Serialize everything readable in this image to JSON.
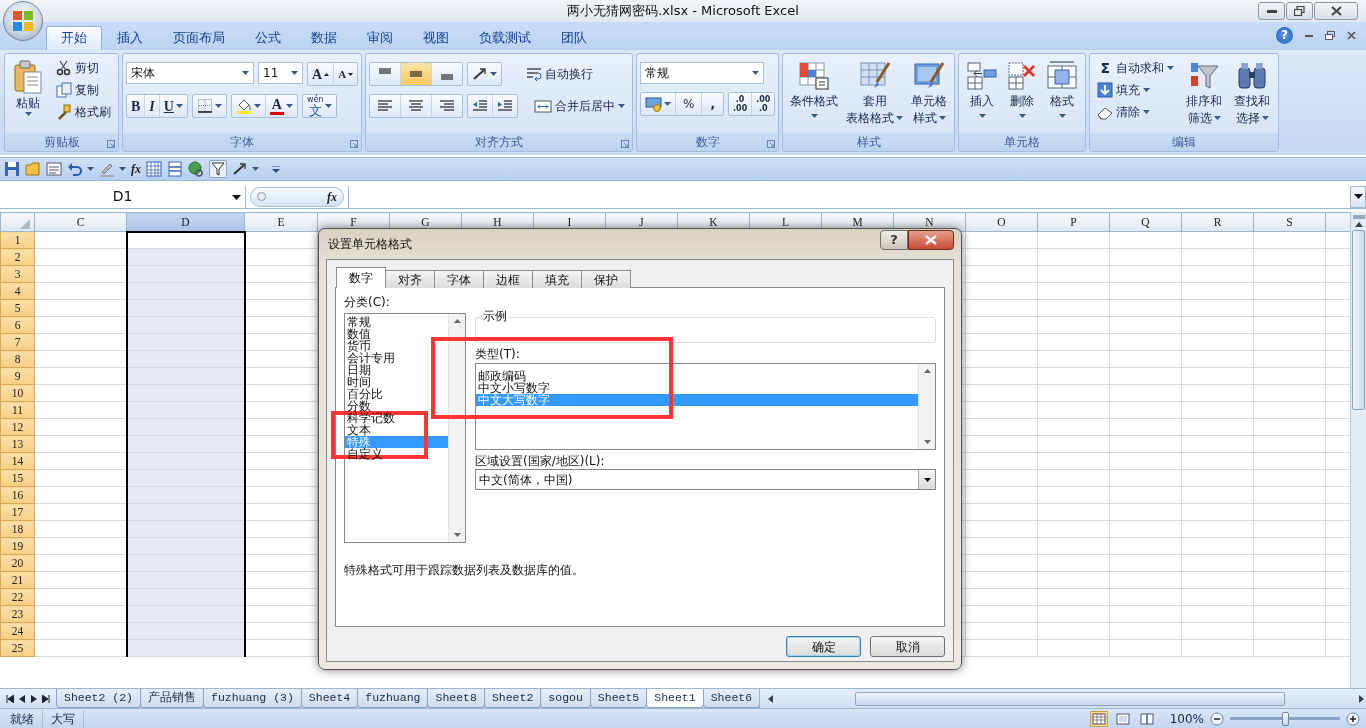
{
  "window": {
    "title": "两小无猜网密码.xlsx - Microsoft Excel"
  },
  "ribbon_tabs": [
    {
      "label": "开始",
      "selected": true
    },
    {
      "label": "插入",
      "selected": false
    },
    {
      "label": "页面布局",
      "selected": false
    },
    {
      "label": "公式",
      "selected": false
    },
    {
      "label": "数据",
      "selected": false
    },
    {
      "label": "审阅",
      "selected": false
    },
    {
      "label": "视图",
      "selected": false
    },
    {
      "label": "负载测试",
      "selected": false
    },
    {
      "label": "团队",
      "selected": false
    }
  ],
  "ribbon_help": "?",
  "clipboard": {
    "title": "剪贴板",
    "launcher": true,
    "paste": "粘贴",
    "actions": [
      {
        "kind": "cut",
        "label": "剪切"
      },
      {
        "kind": "copy",
        "label": "复制"
      },
      {
        "kind": "brush",
        "label": "格式刷"
      }
    ]
  },
  "font": {
    "title": "字体",
    "launcher": true,
    "font_name": "宋体",
    "font_size": "11",
    "grow": "A",
    "shrink": "A",
    "styles": [
      "B",
      "I",
      "U"
    ],
    "font_color": "A",
    "phonetic": {
      "ruby": "wén",
      "char": "文"
    }
  },
  "alignment": {
    "title": "对齐方式",
    "launcher": true,
    "vertical": [
      {
        "selected": false
      },
      {
        "selected": true
      },
      {
        "selected": false
      }
    ],
    "wrap": "自动换行",
    "merge": "合并后居中"
  },
  "number": {
    "title": "数字",
    "launcher": true,
    "format": "常规",
    "percent": "%",
    "comma": ",",
    "decimals": [
      {
        "top": ".0",
        "bottom": ".00"
      },
      {
        "top": ".00",
        "bottom": ".0"
      }
    ]
  },
  "styles": {
    "title": "样式",
    "buttons": [
      {
        "kind": "conditional",
        "lines": [
          "条件格式"
        ]
      },
      {
        "kind": "table",
        "lines": [
          "套用",
          "表格格式"
        ]
      },
      {
        "kind": "cellstyle",
        "lines": [
          "单元格",
          "样式"
        ]
      }
    ]
  },
  "cells": {
    "title": "单元格",
    "buttons": [
      {
        "kind": "insert",
        "lines": [
          "插入"
        ]
      },
      {
        "kind": "delete",
        "lines": [
          "删除"
        ]
      },
      {
        "kind": "format",
        "lines": [
          "格式"
        ]
      }
    ]
  },
  "editing": {
    "title": "编辑",
    "sum_symbol": "Σ",
    "small": [
      {
        "kind": "sum",
        "label": "自动求和"
      },
      {
        "kind": "fill",
        "label": "填充"
      },
      {
        "kind": "clear",
        "label": "清除"
      }
    ],
    "large": [
      {
        "kind": "sort",
        "lines": [
          "排序和",
          "筛选"
        ]
      },
      {
        "kind": "find",
        "lines": [
          "查找和",
          "选择"
        ]
      }
    ]
  },
  "quick_access": {
    "fx": "fx"
  },
  "formula_bar": {
    "name_box": "D1",
    "fx": "fx"
  },
  "grid": {
    "columns": [
      {
        "label": "C",
        "selected": false
      },
      {
        "label": "D",
        "selected": true
      },
      {
        "label": "E",
        "selected": false
      },
      {
        "label": "F",
        "selected": false
      },
      {
        "label": "G",
        "selected": false
      },
      {
        "label": "H",
        "selected": false
      },
      {
        "label": "I",
        "selected": false
      },
      {
        "label": "J",
        "selected": false
      },
      {
        "label": "K",
        "selected": false
      },
      {
        "label": "L",
        "selected": false
      },
      {
        "label": "M",
        "selected": false
      },
      {
        "label": "N",
        "selected": false
      },
      {
        "label": "O",
        "selected": false
      },
      {
        "label": "P",
        "selected": false
      },
      {
        "label": "Q",
        "selected": false
      },
      {
        "label": "R",
        "selected": false
      },
      {
        "label": "S",
        "selected": false
      }
    ],
    "rows": [
      "1",
      "2",
      "3",
      "4",
      "5",
      "6",
      "7",
      "8",
      "9",
      "10",
      "11",
      "12",
      "13",
      "14",
      "15",
      "16",
      "17",
      "18",
      "19",
      "20",
      "21",
      "22",
      "23",
      "24",
      "25"
    ]
  },
  "dialog": {
    "title": "设置单元格格式",
    "help": "?",
    "tabs": [
      {
        "label": "数字",
        "selected": true
      },
      {
        "label": "对齐",
        "selected": false
      },
      {
        "label": "字体",
        "selected": false
      },
      {
        "label": "边框",
        "selected": false
      },
      {
        "label": "填充",
        "selected": false
      },
      {
        "label": "保护",
        "selected": false
      }
    ],
    "category_label": "分类(C):",
    "category_highlight": true,
    "categories": [
      {
        "label": "常规",
        "selected": false
      },
      {
        "label": "数值",
        "selected": false
      },
      {
        "label": "货币",
        "selected": false
      },
      {
        "label": "会计专用",
        "selected": false
      },
      {
        "label": "日期",
        "selected": false
      },
      {
        "label": "时间",
        "selected": false
      },
      {
        "label": "百分比",
        "selected": false
      },
      {
        "label": "分数",
        "selected": false
      },
      {
        "label": "科学记数",
        "selected": false
      },
      {
        "label": "文本",
        "selected": false
      },
      {
        "label": "特殊",
        "selected": true
      },
      {
        "label": "自定义",
        "selected": false
      }
    ],
    "sample_label": "示例",
    "type_label": "类型(T):",
    "type_highlight": true,
    "types": [
      {
        "label": "邮政编码",
        "selected": false
      },
      {
        "label": "中文小写数字",
        "selected": false
      },
      {
        "label": "中文大写数字",
        "selected": true
      }
    ],
    "locale_label": "区域设置(国家/地区)(L):",
    "locale": "中文(简体，中国)",
    "description": "特殊格式可用于跟踪数据列表及数据库的值。",
    "buttons": [
      "确定",
      "取消"
    ]
  },
  "sheet_tabs": [
    {
      "label": "Sheet2 (2)",
      "selected": false
    },
    {
      "label": "产品销售",
      "selected": false
    },
    {
      "label": "fuzhuang (3)",
      "selected": false
    },
    {
      "label": "Sheet4",
      "selected": false
    },
    {
      "label": "fuzhuang",
      "selected": false
    },
    {
      "label": "Sheet8",
      "selected": false
    },
    {
      "label": "Sheet2",
      "selected": false
    },
    {
      "label": "sogou",
      "selected": false
    },
    {
      "label": "Sheet5",
      "selected": false
    },
    {
      "label": "Sheet1",
      "selected": true
    },
    {
      "label": "Sheet6",
      "selected": false
    }
  ],
  "status_bar": {
    "items": [
      "就绪",
      "大写"
    ],
    "views": [
      {
        "kind": "normal",
        "selected": true
      },
      {
        "kind": "layout",
        "selected": false
      },
      {
        "kind": "pagebreak",
        "selected": false
      }
    ],
    "zoom": "100%",
    "zoom_slider": {
      "level": 0.5
    }
  }
}
